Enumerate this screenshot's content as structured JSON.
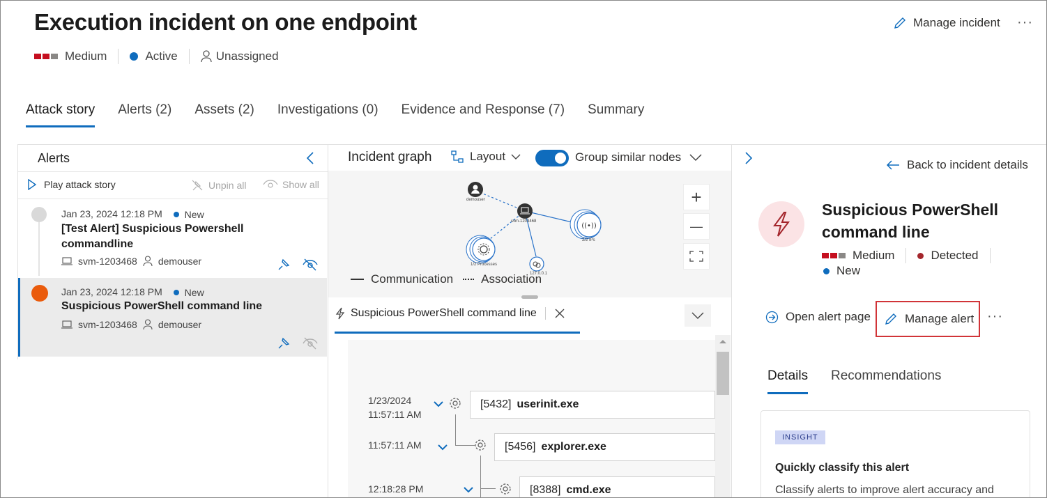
{
  "header": {
    "title": "Execution incident on one endpoint",
    "severity": "Medium",
    "status": "Active",
    "assignee": "Unassigned",
    "manage_label": "Manage incident",
    "more": "···"
  },
  "tabs": [
    {
      "label": "Attack story",
      "active": true
    },
    {
      "label": "Alerts (2)"
    },
    {
      "label": "Assets (2)"
    },
    {
      "label": "Investigations (0)"
    },
    {
      "label": "Evidence and Response (7)"
    },
    {
      "label": "Summary"
    }
  ],
  "alerts_panel": {
    "title": "Alerts",
    "play": "Play attack story",
    "unpin_all": "Unpin all",
    "show_all": "Show all",
    "cards": [
      {
        "time": "Jan 23, 2024 12:18 PM",
        "status": "New",
        "title_line1": "[Test Alert] Suspicious Powershell",
        "title_line2": "commandline",
        "device": "svm-1203468",
        "user": "demouser"
      },
      {
        "time": "Jan 23, 2024 12:18 PM",
        "status": "New",
        "title_line1": "Suspicious PowerShell command line",
        "device": "svm-1203468",
        "user": "demouser"
      }
    ]
  },
  "graph": {
    "title": "Incident graph",
    "layout_label": "Layout",
    "group_label": "Group similar nodes",
    "group_enabled": true,
    "nodes": {
      "user": "demouser",
      "device": "svm-1203468",
      "ip": "2/2 IPs",
      "processes": "1/2 Processes",
      "local": "127.0.0.1"
    },
    "zoom_in": "+",
    "zoom_out": "—",
    "legend_comm": "Communication",
    "legend_assoc": "Association"
  },
  "tree_panel": {
    "tab_title": "Suspicious PowerShell command line",
    "rows": [
      {
        "date": "1/23/2024",
        "time": "11:57:11 AM",
        "pid": "[5432]",
        "name": "userinit.exe"
      },
      {
        "date": "",
        "time": "11:57:11 AM",
        "pid": "[5456]",
        "name": "explorer.exe"
      },
      {
        "date": "",
        "time": "12:18:28 PM",
        "pid": "[8388]",
        "name": "cmd.exe"
      }
    ]
  },
  "right_panel": {
    "back_label": "Back to incident details",
    "alert_title": "Suspicious PowerShell command line",
    "severity": "Medium",
    "detection": "Detected",
    "status": "New",
    "open_alert": "Open alert page",
    "manage_alert": "Manage alert",
    "more": "···",
    "tabs": [
      "Details",
      "Recommendations"
    ],
    "insight": {
      "badge": "INSIGHT",
      "title": "Quickly classify this alert",
      "text": "Classify alerts to improve alert accuracy and"
    }
  },
  "colors": {
    "accent": "#0f6cbd",
    "severity_red": "#c50f1f",
    "severity_grey": "#8a8886",
    "alert_orange": "#ea5b0c",
    "highlight_border": "#d13438"
  }
}
